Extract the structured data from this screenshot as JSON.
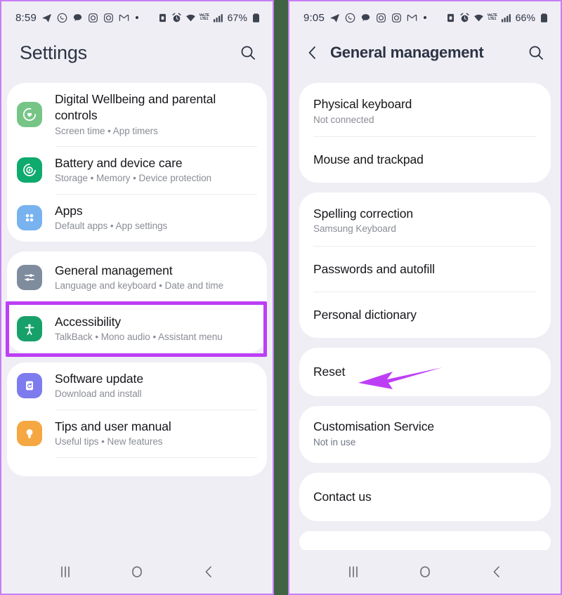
{
  "meta": {
    "accent_purple": "#bd3ff5",
    "panel_border": "#c77ef5",
    "divider_green": "#3f6343",
    "panel_bg": "#efeef4",
    "card_bg": "#ffffff"
  },
  "left_panel": {
    "status_bar": {
      "time": "8:59",
      "battery_percent": "67%",
      "network_label_top": "VoLTE",
      "network_label_bottom": "LTE1",
      "icons": [
        "telegram-icon",
        "whatsapp-icon",
        "chat-icon",
        "instagram-icon",
        "instagram-alt-icon",
        "gmail-icon",
        "more-dot-icon"
      ],
      "right_icons": [
        "sim-lock-icon",
        "alarm-icon",
        "wifi-icon",
        "volte-icon",
        "signal-icon",
        "battery-icon"
      ]
    },
    "appbar": {
      "title": "Settings",
      "search_icon": "search-icon"
    },
    "cards": [
      {
        "rows": [
          {
            "title": "Digital Wellbeing and parental controls",
            "subtitle": "Screen time  •  App timers",
            "icon": "digital-wellbeing-icon",
            "icon_color": "#76c586"
          },
          {
            "title": "Battery and device care",
            "subtitle": "Storage  •  Memory  •  Device protection",
            "icon": "battery-device-care-icon",
            "icon_color": "#0eaa6e"
          },
          {
            "title": "Apps",
            "subtitle": "Default apps  •  App settings",
            "icon": "apps-icon",
            "icon_color": "#78b2ef"
          }
        ]
      },
      {
        "rows": [
          {
            "title": "General management",
            "subtitle": "Language and keyboard  •  Date and time",
            "icon": "general-management-icon",
            "icon_color": "#7e8c9e",
            "highlighted": true
          },
          {
            "title": "Accessibility",
            "subtitle": "TalkBack  •  Mono audio  •  Assistant menu",
            "icon": "accessibility-icon",
            "icon_color": "#17a06a"
          }
        ]
      },
      {
        "rows": [
          {
            "title": "Software update",
            "subtitle": "Download and install",
            "icon": "software-update-icon",
            "icon_color": "#7d7bed"
          },
          {
            "title": "Tips and user manual",
            "subtitle": "Useful tips  •  New features",
            "icon": "tips-icon",
            "icon_color": "#f5a742"
          }
        ]
      }
    ],
    "navbar": [
      "recents-icon",
      "home-icon",
      "back-icon"
    ]
  },
  "right_panel": {
    "status_bar": {
      "time": "9:05",
      "battery_percent": "66%",
      "network_label_top": "VoLTE",
      "network_label_bottom": "LTE1",
      "icons": [
        "telegram-icon",
        "whatsapp-icon",
        "chat-icon",
        "instagram-icon",
        "instagram-alt-icon",
        "gmail-icon",
        "more-dot-icon"
      ],
      "right_icons": [
        "sim-lock-icon",
        "alarm-icon",
        "wifi-icon",
        "volte-icon",
        "signal-icon",
        "battery-icon"
      ]
    },
    "appbar": {
      "back_icon": "back-chevron-icon",
      "title": "General management",
      "search_icon": "search-icon"
    },
    "cards": [
      {
        "rows": [
          {
            "title": "Physical keyboard",
            "subtitle": "Not connected"
          },
          {
            "title": "Mouse and trackpad",
            "subtitle": ""
          }
        ]
      },
      {
        "rows": [
          {
            "title": "Spelling correction",
            "subtitle": "Samsung Keyboard"
          },
          {
            "title": "Passwords and autofill",
            "subtitle": ""
          },
          {
            "title": "Personal dictionary",
            "subtitle": ""
          }
        ]
      },
      {
        "rows": [
          {
            "title": "Reset",
            "subtitle": "",
            "annotated": true
          }
        ]
      },
      {
        "rows": [
          {
            "title": "Customisation Service",
            "subtitle": "Not in use",
            "sub_accent": true
          }
        ]
      },
      {
        "rows": [
          {
            "title": "Contact us",
            "subtitle": ""
          }
        ]
      }
    ],
    "navbar": [
      "recents-icon",
      "home-icon",
      "back-icon"
    ]
  }
}
